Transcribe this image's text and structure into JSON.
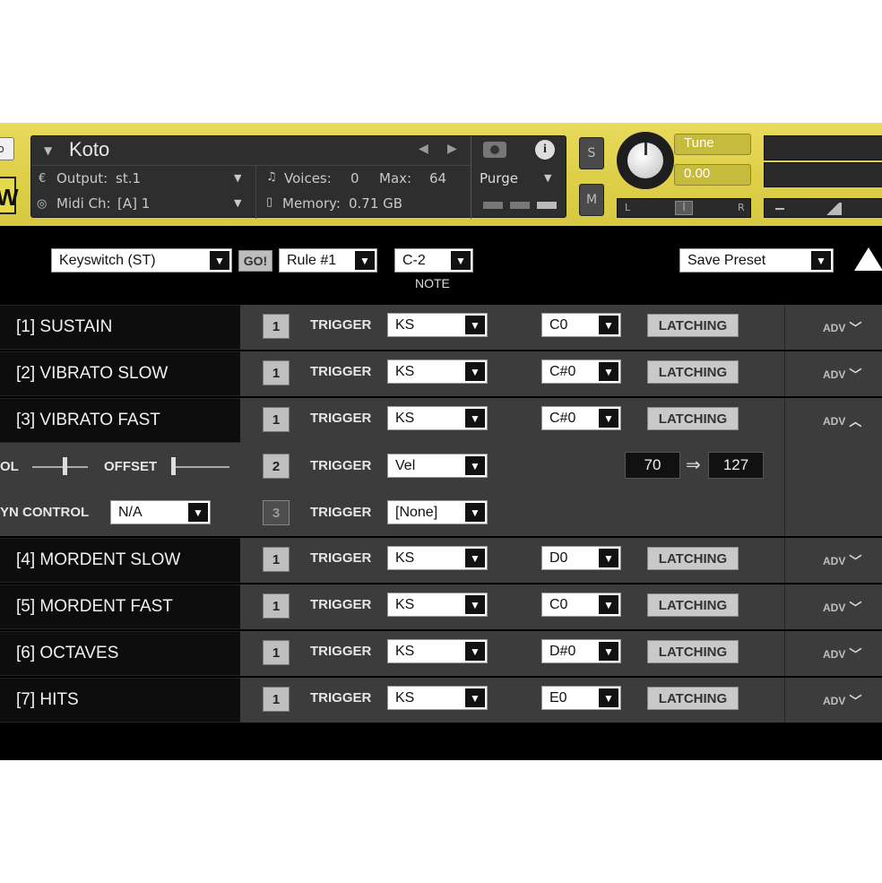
{
  "header": {
    "instrument_name": "Koto",
    "output_label": "Output:",
    "output_value": "st.1",
    "voices_label": "Voices:",
    "voices_value": "0",
    "max_label": "Max:",
    "max_value": "64",
    "midi_label": "Midi Ch:",
    "midi_value": "[A]  1",
    "memory_label": "Memory:",
    "memory_value": "0.71 GB",
    "purge_label": "Purge",
    "solo_label": "S",
    "mute_label": "M",
    "tune_label": "Tune",
    "tune_value": "0.00",
    "pan_left": "L",
    "pan_right": "R",
    "logo_letter": "W"
  },
  "toolbar": {
    "articulation_mode": "Keyswitch (ST)",
    "go_label": "GO!",
    "rule": "Rule #1",
    "note": "C-2",
    "note_caption": "NOTE",
    "save_preset": "Save Preset"
  },
  "articulations": [
    {
      "name": "[1]  SUSTAIN",
      "num": "1",
      "trigger": "TRIGGER",
      "type": "KS",
      "key": "C0",
      "latch": "LATCHING",
      "adv": "ADV"
    },
    {
      "name": "[2]  VIBRATO SLOW",
      "num": "1",
      "trigger": "TRIGGER",
      "type": "KS",
      "key": "C#0",
      "latch": "LATCHING",
      "adv": "ADV"
    },
    {
      "name": "[3]  VIBRATO FAST",
      "num": "1",
      "trigger": "TRIGGER",
      "type": "KS",
      "key": "C#0",
      "latch": "LATCHING",
      "adv": "ADV"
    },
    {
      "name": "[4]  MORDENT SLOW",
      "num": "1",
      "trigger": "TRIGGER",
      "type": "KS",
      "key": "D0",
      "latch": "LATCHING",
      "adv": "ADV"
    },
    {
      "name": "[5]  MORDENT FAST",
      "num": "1",
      "trigger": "TRIGGER",
      "type": "KS",
      "key": "C0",
      "latch": "LATCHING",
      "adv": "ADV"
    },
    {
      "name": "[6]  OCTAVES",
      "num": "1",
      "trigger": "TRIGGER",
      "type": "KS",
      "key": "D#0",
      "latch": "LATCHING",
      "adv": "ADV"
    },
    {
      "name": "[7]  HITS",
      "num": "1",
      "trigger": "TRIGGER",
      "type": "KS",
      "key": "E0",
      "latch": "LATCHING",
      "adv": "ADV"
    }
  ],
  "expanded": {
    "vol_label": "OL",
    "offset_label": "OFFSET",
    "dyn_label": "YN CONTROL",
    "dyn_value": "N/A",
    "trigger2": {
      "num": "2",
      "label": "TRIGGER",
      "type": "Vel",
      "min": "70",
      "max": "127"
    },
    "trigger3": {
      "num": "3",
      "label": "TRIGGER",
      "type": "[None]"
    }
  },
  "colors": {
    "header_yellow": "#dfd04a",
    "panel_black": "#000000",
    "row_gray": "#3c3c3c"
  }
}
